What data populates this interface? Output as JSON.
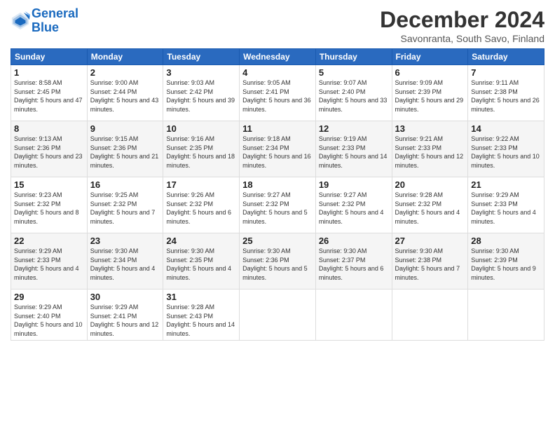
{
  "header": {
    "logo_line1": "General",
    "logo_line2": "Blue",
    "month": "December 2024",
    "location": "Savonranta, South Savo, Finland"
  },
  "weekdays": [
    "Sunday",
    "Monday",
    "Tuesday",
    "Wednesday",
    "Thursday",
    "Friday",
    "Saturday"
  ],
  "weeks": [
    [
      {
        "day": "1",
        "sunrise": "8:58 AM",
        "sunset": "2:45 PM",
        "daylight": "5 hours and 47 minutes."
      },
      {
        "day": "2",
        "sunrise": "9:00 AM",
        "sunset": "2:44 PM",
        "daylight": "5 hours and 43 minutes."
      },
      {
        "day": "3",
        "sunrise": "9:03 AM",
        "sunset": "2:42 PM",
        "daylight": "5 hours and 39 minutes."
      },
      {
        "day": "4",
        "sunrise": "9:05 AM",
        "sunset": "2:41 PM",
        "daylight": "5 hours and 36 minutes."
      },
      {
        "day": "5",
        "sunrise": "9:07 AM",
        "sunset": "2:40 PM",
        "daylight": "5 hours and 33 minutes."
      },
      {
        "day": "6",
        "sunrise": "9:09 AM",
        "sunset": "2:39 PM",
        "daylight": "5 hours and 29 minutes."
      },
      {
        "day": "7",
        "sunrise": "9:11 AM",
        "sunset": "2:38 PM",
        "daylight": "5 hours and 26 minutes."
      }
    ],
    [
      {
        "day": "8",
        "sunrise": "9:13 AM",
        "sunset": "2:36 PM",
        "daylight": "5 hours and 23 minutes."
      },
      {
        "day": "9",
        "sunrise": "9:15 AM",
        "sunset": "2:36 PM",
        "daylight": "5 hours and 21 minutes."
      },
      {
        "day": "10",
        "sunrise": "9:16 AM",
        "sunset": "2:35 PM",
        "daylight": "5 hours and 18 minutes."
      },
      {
        "day": "11",
        "sunrise": "9:18 AM",
        "sunset": "2:34 PM",
        "daylight": "5 hours and 16 minutes."
      },
      {
        "day": "12",
        "sunrise": "9:19 AM",
        "sunset": "2:33 PM",
        "daylight": "5 hours and 14 minutes."
      },
      {
        "day": "13",
        "sunrise": "9:21 AM",
        "sunset": "2:33 PM",
        "daylight": "5 hours and 12 minutes."
      },
      {
        "day": "14",
        "sunrise": "9:22 AM",
        "sunset": "2:33 PM",
        "daylight": "5 hours and 10 minutes."
      }
    ],
    [
      {
        "day": "15",
        "sunrise": "9:23 AM",
        "sunset": "2:32 PM",
        "daylight": "5 hours and 8 minutes."
      },
      {
        "day": "16",
        "sunrise": "9:25 AM",
        "sunset": "2:32 PM",
        "daylight": "5 hours and 7 minutes."
      },
      {
        "day": "17",
        "sunrise": "9:26 AM",
        "sunset": "2:32 PM",
        "daylight": "5 hours and 6 minutes."
      },
      {
        "day": "18",
        "sunrise": "9:27 AM",
        "sunset": "2:32 PM",
        "daylight": "5 hours and 5 minutes."
      },
      {
        "day": "19",
        "sunrise": "9:27 AM",
        "sunset": "2:32 PM",
        "daylight": "5 hours and 4 minutes."
      },
      {
        "day": "20",
        "sunrise": "9:28 AM",
        "sunset": "2:32 PM",
        "daylight": "5 hours and 4 minutes."
      },
      {
        "day": "21",
        "sunrise": "9:29 AM",
        "sunset": "2:33 PM",
        "daylight": "5 hours and 4 minutes."
      }
    ],
    [
      {
        "day": "22",
        "sunrise": "9:29 AM",
        "sunset": "2:33 PM",
        "daylight": "5 hours and 4 minutes."
      },
      {
        "day": "23",
        "sunrise": "9:30 AM",
        "sunset": "2:34 PM",
        "daylight": "5 hours and 4 minutes."
      },
      {
        "day": "24",
        "sunrise": "9:30 AM",
        "sunset": "2:35 PM",
        "daylight": "5 hours and 4 minutes."
      },
      {
        "day": "25",
        "sunrise": "9:30 AM",
        "sunset": "2:36 PM",
        "daylight": "5 hours and 5 minutes."
      },
      {
        "day": "26",
        "sunrise": "9:30 AM",
        "sunset": "2:37 PM",
        "daylight": "5 hours and 6 minutes."
      },
      {
        "day": "27",
        "sunrise": "9:30 AM",
        "sunset": "2:38 PM",
        "daylight": "5 hours and 7 minutes."
      },
      {
        "day": "28",
        "sunrise": "9:30 AM",
        "sunset": "2:39 PM",
        "daylight": "5 hours and 9 minutes."
      }
    ],
    [
      {
        "day": "29",
        "sunrise": "9:29 AM",
        "sunset": "2:40 PM",
        "daylight": "5 hours and 10 minutes."
      },
      {
        "day": "30",
        "sunrise": "9:29 AM",
        "sunset": "2:41 PM",
        "daylight": "5 hours and 12 minutes."
      },
      {
        "day": "31",
        "sunrise": "9:28 AM",
        "sunset": "2:43 PM",
        "daylight": "5 hours and 14 minutes."
      },
      null,
      null,
      null,
      null
    ]
  ]
}
